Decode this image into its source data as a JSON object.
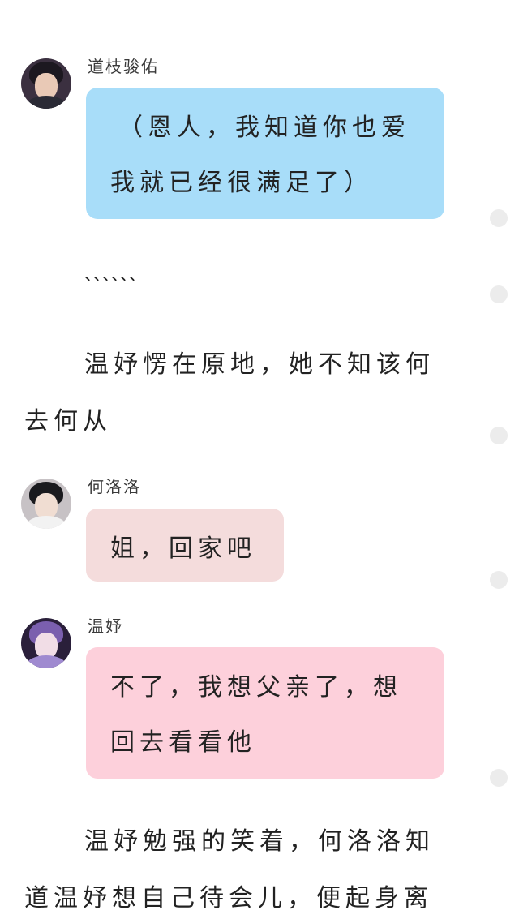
{
  "messages": [
    {
      "name": "道枝骏佑",
      "lines": [
        "（恩人，我知道你也爱",
        "我就已经很满足了）"
      ],
      "bubble_color": "#a8ddf9"
    },
    {
      "name": "何洛洛",
      "lines": [
        "姐，回家吧"
      ],
      "bubble_color": "#f4dcdc"
    },
    {
      "name": "温妤",
      "lines": [
        "不了，我想父亲了，想",
        "回去看看他"
      ],
      "bubble_color": "#fdd0db"
    }
  ],
  "narration": {
    "ellipsis": "、、、、、、",
    "p1": [
      "温妤愣在原地，她不知该何",
      "去何从"
    ],
    "p2": [
      "温妤勉强的笑着，何洛洛知",
      "道温妤想自己待会儿，便起身离"
    ]
  },
  "side_icons": [
    "scroll-dot",
    "scroll-dot",
    "scroll-dot",
    "scroll-dot",
    "scroll-dot"
  ]
}
